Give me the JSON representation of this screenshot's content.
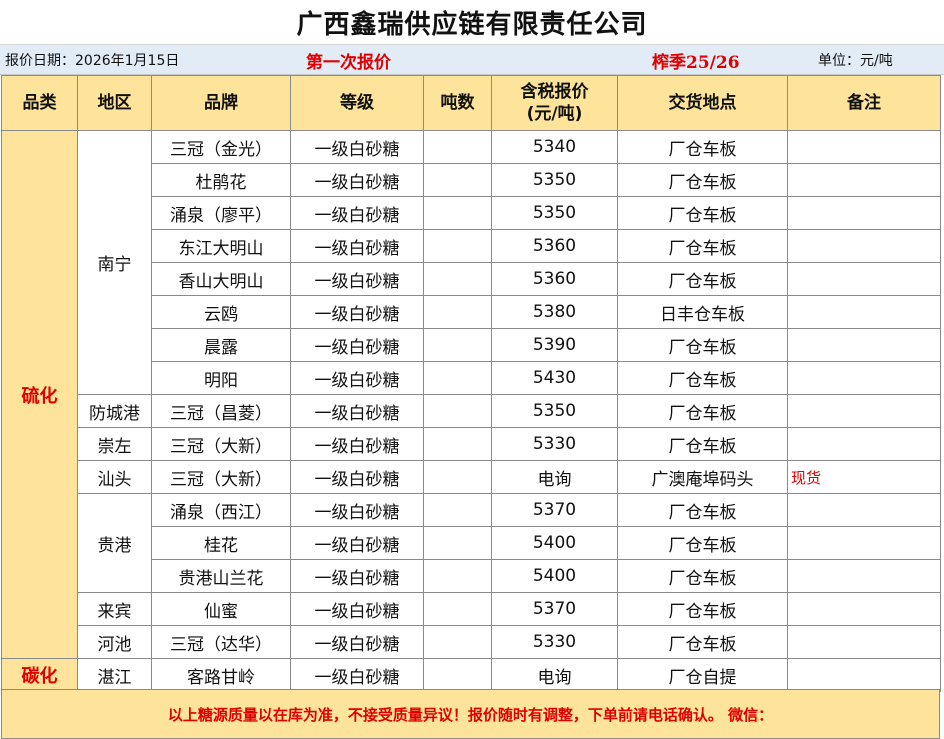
{
  "title": "广西鑫瑞供应链有限责任公司",
  "info": {
    "date_label": "报价日期：2026年1月15日",
    "round": "第一次报价",
    "season": "榨季25/26",
    "unit": "单位：元/吨"
  },
  "headers": {
    "category": "品类",
    "region": "地区",
    "brand": "品牌",
    "grade": "等级",
    "tonnage": "吨数",
    "price_line1": "含税报价",
    "price_line2": "(元/吨)",
    "delivery": "交货地点",
    "remark": "备注"
  },
  "categories": {
    "sulfurized": "硫化",
    "carbonated": "碳化"
  },
  "regions": {
    "nanning": "南宁",
    "fangchenggang": "防城港",
    "chongzuo": "崇左",
    "shantou": "汕头",
    "guigang": "贵港",
    "laibin": "来宾",
    "hechi": "河池",
    "zhanjiang": "湛江"
  },
  "rows": [
    {
      "brand": "三冠（金光）",
      "grade": "一级白砂糖",
      "tonnage": "",
      "price": "5340",
      "delivery": "厂仓车板",
      "remark": ""
    },
    {
      "brand": "杜鹃花",
      "grade": "一级白砂糖",
      "tonnage": "",
      "price": "5350",
      "delivery": "厂仓车板",
      "remark": ""
    },
    {
      "brand": "涌泉（廖平）",
      "grade": "一级白砂糖",
      "tonnage": "",
      "price": "5350",
      "delivery": "厂仓车板",
      "remark": ""
    },
    {
      "brand": "东江大明山",
      "grade": "一级白砂糖",
      "tonnage": "",
      "price": "5360",
      "delivery": "厂仓车板",
      "remark": ""
    },
    {
      "brand": "香山大明山",
      "grade": "一级白砂糖",
      "tonnage": "",
      "price": "5360",
      "delivery": "厂仓车板",
      "remark": ""
    },
    {
      "brand": "云鸥",
      "grade": "一级白砂糖",
      "tonnage": "",
      "price": "5380",
      "delivery": "日丰仓车板",
      "remark": ""
    },
    {
      "brand": "晨露",
      "grade": "一级白砂糖",
      "tonnage": "",
      "price": "5390",
      "delivery": "厂仓车板",
      "remark": ""
    },
    {
      "brand": "明阳",
      "grade": "一级白砂糖",
      "tonnage": "",
      "price": "5430",
      "delivery": "厂仓车板",
      "remark": ""
    },
    {
      "brand": "三冠（昌菱）",
      "grade": "一级白砂糖",
      "tonnage": "",
      "price": "5350",
      "delivery": "厂仓车板",
      "remark": ""
    },
    {
      "brand": "三冠（大新）",
      "grade": "一级白砂糖",
      "tonnage": "",
      "price": "5330",
      "delivery": "厂仓车板",
      "remark": ""
    },
    {
      "brand": "三冠（大新）",
      "grade": "一级白砂糖",
      "tonnage": "",
      "price": "电询",
      "delivery": "广澳庵埠码头",
      "remark": "现货"
    },
    {
      "brand": "涌泉（西江）",
      "grade": "一级白砂糖",
      "tonnage": "",
      "price": "5370",
      "delivery": "厂仓车板",
      "remark": ""
    },
    {
      "brand": "桂花",
      "grade": "一级白砂糖",
      "tonnage": "",
      "price": "5400",
      "delivery": "厂仓车板",
      "remark": ""
    },
    {
      "brand": "贵港山兰花",
      "grade": "一级白砂糖",
      "tonnage": "",
      "price": "5400",
      "delivery": "厂仓车板",
      "remark": ""
    },
    {
      "brand": "仙蜜",
      "grade": "一级白砂糖",
      "tonnage": "",
      "price": "5370",
      "delivery": "厂仓车板",
      "remark": ""
    },
    {
      "brand": "三冠（达华）",
      "grade": "一级白砂糖",
      "tonnage": "",
      "price": "5330",
      "delivery": "厂仓车板",
      "remark": ""
    },
    {
      "brand": "客路甘岭",
      "grade": "一级白砂糖",
      "tonnage": "",
      "price": "电询",
      "delivery": "厂仓自提",
      "remark": ""
    }
  ],
  "footer": "以上糖源质量以在库为准，不接受质量异议！报价随时有调整，下单前请电话确认。 微信：",
  "colors": {
    "header_bg": "#fde49a",
    "info_bg": "#e2ecf7",
    "accent_red": "#e00000"
  }
}
